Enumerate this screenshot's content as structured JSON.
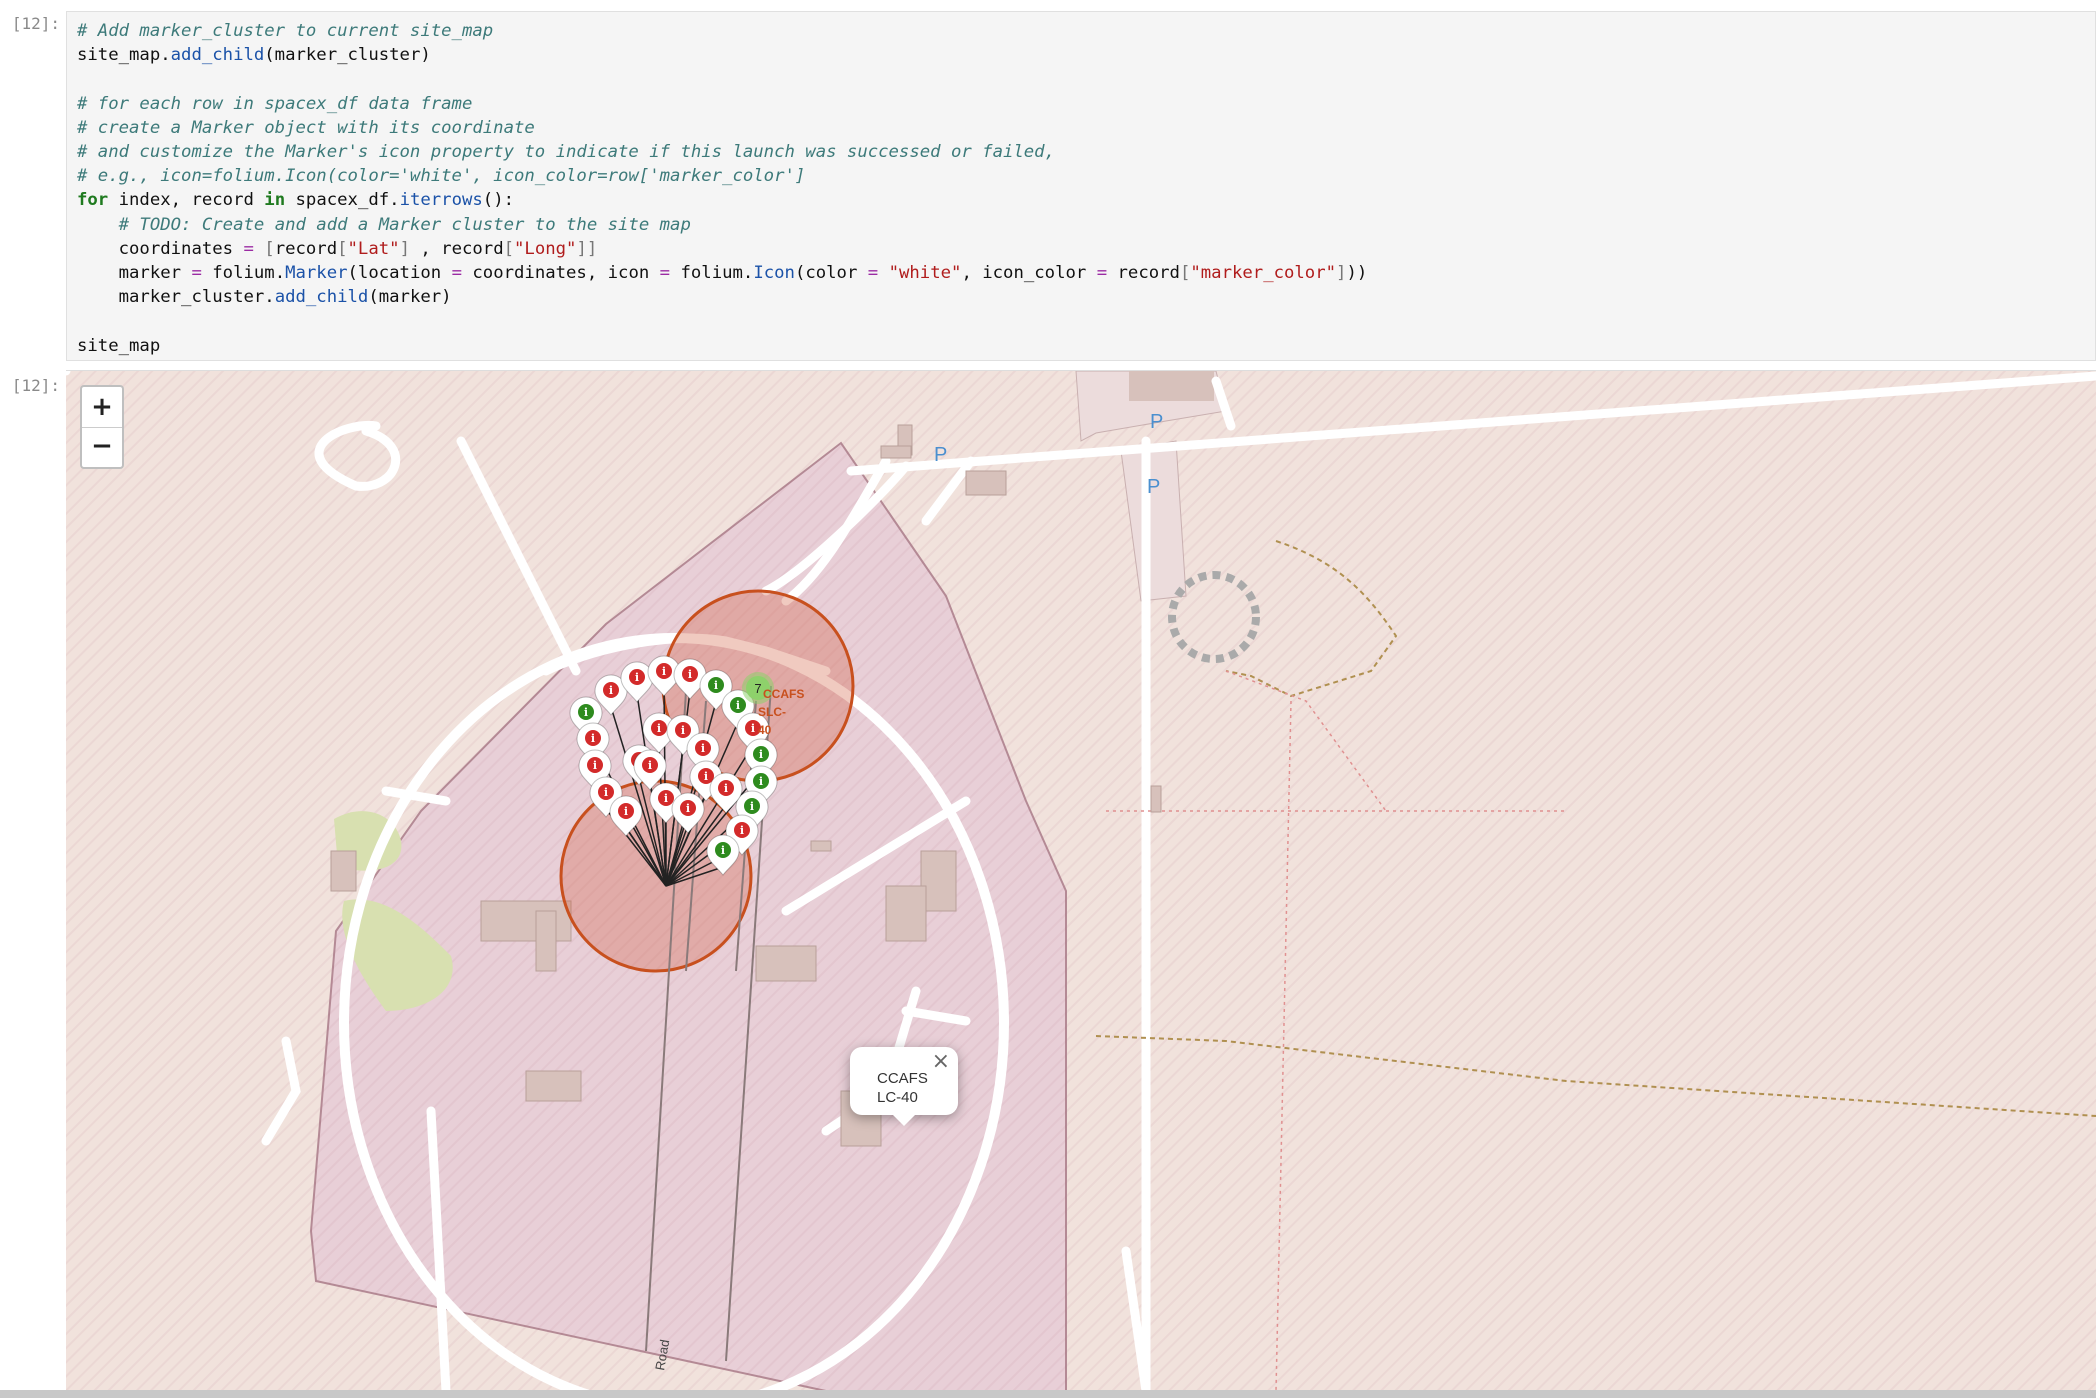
{
  "cells": {
    "code_prompt": "[12]:",
    "output_prompt": "[12]:"
  },
  "code_lines": [
    [
      [
        "cm",
        "# Add marker_cluster to current site_map"
      ]
    ],
    [
      [
        "",
        "site_map."
      ],
      [
        "fn",
        "add_child"
      ],
      [
        "",
        "(marker_cluster)"
      ]
    ],
    [],
    [
      [
        "cm",
        "# for each row in spacex_df data frame"
      ]
    ],
    [
      [
        "cm",
        "# create a Marker object with its coordinate"
      ]
    ],
    [
      [
        "cm",
        "# and customize the Marker's icon property to indicate if this launch was successed or failed,"
      ]
    ],
    [
      [
        "cm",
        "# e.g., icon=folium.Icon(color='white', icon_color=row['marker_color']"
      ]
    ],
    [
      [
        "kw",
        "for"
      ],
      [
        "",
        " index, record "
      ],
      [
        "kw",
        "in"
      ],
      [
        "",
        " spacex_df."
      ],
      [
        "fn",
        "iterrows"
      ],
      [
        "",
        "():"
      ]
    ],
    [
      [
        "",
        "    "
      ],
      [
        "cm",
        "# TODO: Create and add a Marker cluster to the site map"
      ]
    ],
    [
      [
        "",
        "    coordinates "
      ],
      [
        "op",
        "="
      ],
      [
        "",
        " "
      ],
      [
        "br",
        "["
      ],
      [
        "",
        "record"
      ],
      [
        "br",
        "["
      ],
      [
        "st",
        "\"Lat\""
      ],
      [
        "br",
        "]"
      ],
      [
        "",
        " , record"
      ],
      [
        "br",
        "["
      ],
      [
        "st",
        "\"Long\""
      ],
      [
        "br",
        "]]"
      ]
    ],
    [
      [
        "",
        "    marker "
      ],
      [
        "op",
        "="
      ],
      [
        "",
        " folium."
      ],
      [
        "fn",
        "Marker"
      ],
      [
        "",
        "(location "
      ],
      [
        "op",
        "="
      ],
      [
        "",
        " coordinates, icon "
      ],
      [
        "op",
        "="
      ],
      [
        "",
        " folium."
      ],
      [
        "fn",
        "Icon"
      ],
      [
        "",
        "(color "
      ],
      [
        "op",
        "="
      ],
      [
        "",
        " "
      ],
      [
        "st",
        "\"white\""
      ],
      [
        "",
        ", icon_color "
      ],
      [
        "op",
        "="
      ],
      [
        "",
        " record"
      ],
      [
        "br",
        "["
      ],
      [
        "st",
        "\"marker_color\""
      ],
      [
        "br",
        "]"
      ],
      [
        "",
        "))"
      ]
    ],
    [
      [
        "",
        "    marker_cluster."
      ],
      [
        "fn",
        "add_child"
      ],
      [
        "",
        "(marker)"
      ]
    ],
    [],
    [
      [
        "",
        "site_map"
      ]
    ]
  ],
  "map": {
    "zoom_in_label": "+",
    "zoom_out_label": "−",
    "cluster_count": "7",
    "site_label_lines": [
      "CCAFS",
      "SLC-",
      "40"
    ],
    "parking_labels": [
      "P",
      "P",
      "P"
    ],
    "road_label": "Road",
    "popup": {
      "line1": "CCAFS",
      "line2": "LC-40",
      "close": "×"
    },
    "marker_icon_glyph": "i",
    "marker_colors": [
      "red",
      "red",
      "red",
      "red",
      "green",
      "green",
      "red",
      "green",
      "green",
      "green",
      "red",
      "green",
      "green",
      "red",
      "red",
      "red",
      "red",
      "red",
      "red",
      "red",
      "red",
      "red",
      "red",
      "red",
      "red",
      "red"
    ],
    "colors": {
      "success": "#2e8b1e",
      "failure": "#d32a2a",
      "cluster": "#8ed16b",
      "circle": "#c8501e"
    }
  }
}
